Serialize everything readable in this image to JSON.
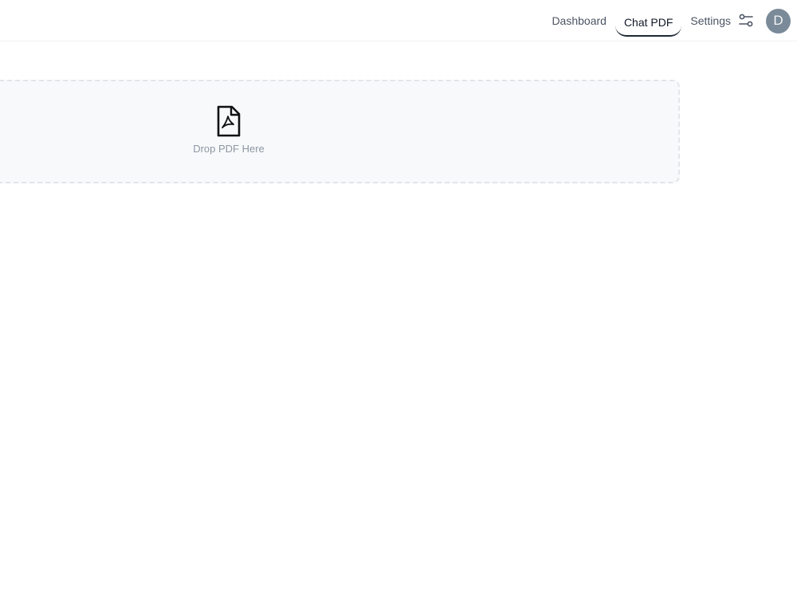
{
  "nav": {
    "items": [
      {
        "label": "Dashboard",
        "active": false
      },
      {
        "label": "Chat PDF",
        "active": true
      }
    ],
    "settings_label": "Settings",
    "settings_icon": "sliders-icon"
  },
  "user": {
    "avatar_initial": "D",
    "avatar_color": "#7a8a98"
  },
  "dropzone": {
    "label": "Drop PDF Here",
    "icon": "pdf-file-icon"
  }
}
